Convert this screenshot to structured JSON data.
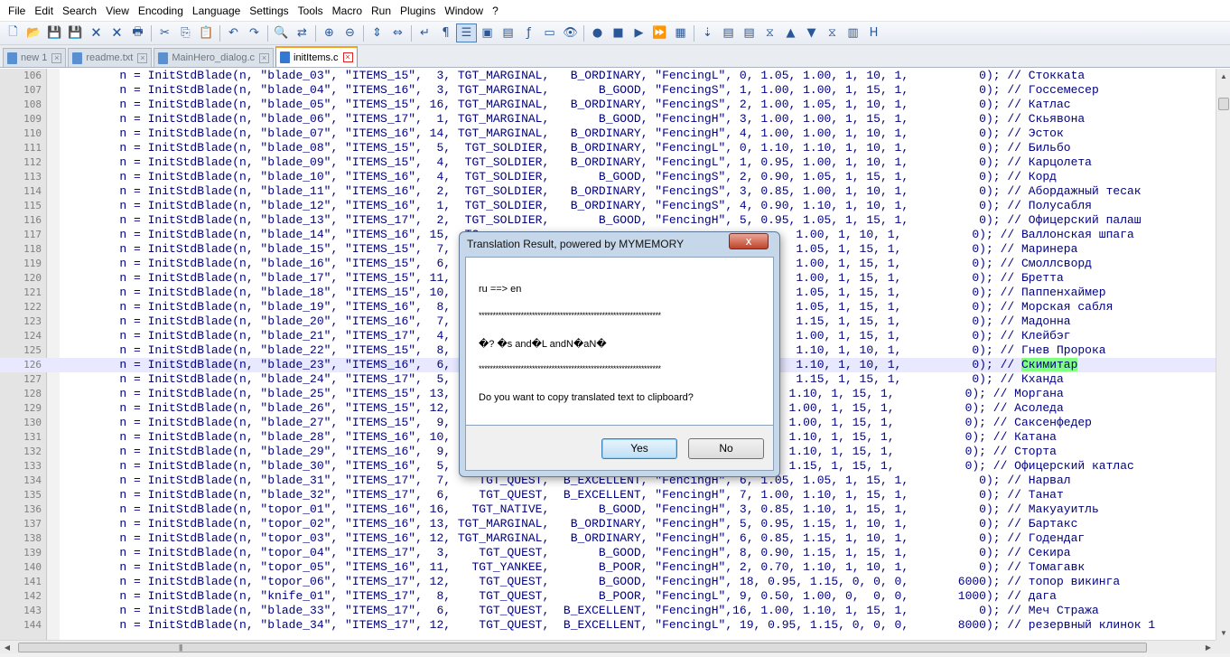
{
  "menu": [
    "File",
    "Edit",
    "Search",
    "View",
    "Encoding",
    "Language",
    "Settings",
    "Tools",
    "Macro",
    "Run",
    "Plugins",
    "Window",
    "?"
  ],
  "toolbar": {
    "icons": [
      {
        "name": "new-file-icon",
        "glyph": "🗋"
      },
      {
        "name": "open-file-icon",
        "glyph": "📂"
      },
      {
        "name": "save-icon",
        "glyph": "💾"
      },
      {
        "name": "save-all-icon",
        "glyph": "💾"
      },
      {
        "name": "close-icon",
        "glyph": "🗙"
      },
      {
        "name": "close-all-icon",
        "glyph": "🗙"
      },
      {
        "name": "print-icon",
        "glyph": "🖶"
      },
      {
        "sep": true
      },
      {
        "name": "cut-icon",
        "glyph": "✂"
      },
      {
        "name": "copy-icon",
        "glyph": "⎘"
      },
      {
        "name": "paste-icon",
        "glyph": "📋"
      },
      {
        "sep": true
      },
      {
        "name": "undo-icon",
        "glyph": "↶"
      },
      {
        "name": "redo-icon",
        "glyph": "↷"
      },
      {
        "sep": true
      },
      {
        "name": "find-icon",
        "glyph": "🔍"
      },
      {
        "name": "replace-icon",
        "glyph": "⇄"
      },
      {
        "sep": true
      },
      {
        "name": "zoom-in-icon",
        "glyph": "⊕"
      },
      {
        "name": "zoom-out-icon",
        "glyph": "⊖"
      },
      {
        "sep": true
      },
      {
        "name": "sync-vertical-icon",
        "glyph": "⇕"
      },
      {
        "name": "sync-horizontal-icon",
        "glyph": "⇔"
      },
      {
        "sep": true
      },
      {
        "name": "word-wrap-icon",
        "glyph": "↵"
      },
      {
        "name": "show-all-chars-icon",
        "glyph": "¶"
      },
      {
        "name": "indent-guide-icon",
        "glyph": "☰",
        "active": true
      },
      {
        "name": "user-lang-icon",
        "glyph": "▣"
      },
      {
        "name": "doc-map-icon",
        "glyph": "▤"
      },
      {
        "name": "function-list-icon",
        "glyph": "ƒ"
      },
      {
        "name": "folder-workspace-icon",
        "glyph": "▭"
      },
      {
        "name": "monitoring-icon",
        "glyph": "👁"
      },
      {
        "sep": true
      },
      {
        "name": "record-macro-icon",
        "glyph": "●"
      },
      {
        "name": "stop-record-icon",
        "glyph": "■"
      },
      {
        "name": "play-macro-icon",
        "glyph": "▶"
      },
      {
        "name": "run-macro-multiple-icon",
        "glyph": "⏩"
      },
      {
        "name": "save-macro-icon",
        "glyph": "▦"
      },
      {
        "sep": true
      },
      {
        "name": "translate-icon",
        "glyph": "⇣"
      },
      {
        "name": "plugin-a-icon",
        "glyph": "▤"
      },
      {
        "name": "plugin-b-icon",
        "glyph": "▤"
      },
      {
        "name": "plugin-c-icon",
        "glyph": "⧖"
      },
      {
        "name": "arrow-up-icon",
        "glyph": "▲"
      },
      {
        "name": "arrow-down-icon",
        "glyph": "▼"
      },
      {
        "name": "plugin-d-icon",
        "glyph": "⧖"
      },
      {
        "name": "plugin-e-icon",
        "glyph": "▥"
      },
      {
        "name": "plugin-h-icon",
        "glyph": "H"
      }
    ]
  },
  "tabs": [
    {
      "label": "new 1",
      "active": false
    },
    {
      "label": "readme.txt",
      "active": false
    },
    {
      "label": "MainHero_dialog.c",
      "active": false
    },
    {
      "label": "initItems.c",
      "active": true
    }
  ],
  "editor": {
    "current_line": 126,
    "highlight_word": "Скимитар",
    "lines": [
      {
        "n": "106",
        "text": "        n = InitStdBlade(n, \"blade_03\", \"ITEMS_15\",  3, TGT_MARGINAL,   B_ORDINARY, \"FencingL\", 0, 1.05, 1.00, 1, 10, 1,          0); // Стоккаta"
      },
      {
        "n": "107",
        "text": "        n = InitStdBlade(n, \"blade_04\", \"ITEMS_16\",  3, TGT_MARGINAL,       B_GOOD, \"FencingS\", 1, 1.00, 1.00, 1, 15, 1,          0); // Госсемесер"
      },
      {
        "n": "108",
        "text": "        n = InitStdBlade(n, \"blade_05\", \"ITEMS_15\", 16, TGT_MARGINAL,   B_ORDINARY, \"FencingS\", 2, 1.00, 1.05, 1, 10, 1,          0); // Катлас"
      },
      {
        "n": "109",
        "text": "        n = InitStdBlade(n, \"blade_06\", \"ITEMS_17\",  1, TGT_MARGINAL,       B_GOOD, \"FencingH\", 3, 1.00, 1.00, 1, 15, 1,          0); // Скьявона"
      },
      {
        "n": "110",
        "text": "        n = InitStdBlade(n, \"blade_07\", \"ITEMS_16\", 14, TGT_MARGINAL,   B_ORDINARY, \"FencingH\", 4, 1.00, 1.00, 1, 10, 1,          0); // Эсток"
      },
      {
        "n": "111",
        "text": "        n = InitStdBlade(n, \"blade_08\", \"ITEMS_15\",  5,  TGT_SOLDIER,   B_ORDINARY, \"FencingL\", 0, 1.10, 1.10, 1, 10, 1,          0); // Бильбо"
      },
      {
        "n": "112",
        "text": "        n = InitStdBlade(n, \"blade_09\", \"ITEMS_15\",  4,  TGT_SOLDIER,   B_ORDINARY, \"FencingL\", 1, 0.95, 1.00, 1, 10, 1,          0); // Карцолета"
      },
      {
        "n": "113",
        "text": "        n = InitStdBlade(n, \"blade_10\", \"ITEMS_16\",  4,  TGT_SOLDIER,       B_GOOD, \"FencingS\", 2, 0.90, 1.05, 1, 15, 1,          0); // Корд"
      },
      {
        "n": "114",
        "text": "        n = InitStdBlade(n, \"blade_11\", \"ITEMS_16\",  2,  TGT_SOLDIER,   B_ORDINARY, \"FencingS\", 3, 0.85, 1.00, 1, 10, 1,          0); // Абордажный тесак"
      },
      {
        "n": "115",
        "text": "        n = InitStdBlade(n, \"blade_12\", \"ITEMS_16\",  1,  TGT_SOLDIER,   B_ORDINARY, \"FencingS\", 4, 0.90, 1.10, 1, 10, 1,          0); // Полусабля"
      },
      {
        "n": "116",
        "text": "        n = InitStdBlade(n, \"blade_13\", \"ITEMS_17\",  2,  TGT_SOLDIER,       B_GOOD, \"FencingH\", 5, 0.95, 1.05, 1, 15, 1,          0); // Офицерский палаш"
      },
      {
        "n": "117",
        "text": "        n = InitStdBlade(n, \"blade_14\", \"ITEMS_16\", 15,  TG                                             1.00, 1, 10, 1,          0); // Валлонская шпага"
      },
      {
        "n": "118",
        "text": "        n = InitStdBlade(n, \"blade_15\", \"ITEMS_15\",  7,  TG                                             1.05, 1, 15, 1,          0); // Маринера"
      },
      {
        "n": "119",
        "text": "        n = InitStdBlade(n, \"blade_16\", \"ITEMS_15\",  6,  TG                                             1.00, 1, 15, 1,          0); // Смоллсворд"
      },
      {
        "n": "120",
        "text": "        n = InitStdBlade(n, \"blade_17\", \"ITEMS_15\", 11,  TG                                             1.00, 1, 15, 1,          0); // Бретта"
      },
      {
        "n": "121",
        "text": "        n = InitStdBlade(n, \"blade_18\", \"ITEMS_15\", 10,  TG                                             1.05, 1, 15, 1,          0); // Паппенхаймер"
      },
      {
        "n": "122",
        "text": "        n = InitStdBlade(n, \"blade_19\", \"ITEMS_16\",  8,  TG                                             1.05, 1, 15, 1,          0); // Морская сабля"
      },
      {
        "n": "123",
        "text": "        n = InitStdBlade(n, \"blade_20\", \"ITEMS_16\",  7,  TG                                             1.15, 1, 15, 1,          0); // Мадонна"
      },
      {
        "n": "124",
        "text": "        n = InitStdBlade(n, \"blade_21\", \"ITEMS_17\",  4,  TG                                             1.00, 1, 15, 1,          0); // Клейбэг"
      },
      {
        "n": "125",
        "text": "        n = InitStdBlade(n, \"blade_22\", \"ITEMS_15\",  8,  TG                                             1.10, 1, 10, 1,          0); // Гнев Пророка"
      },
      {
        "n": "126",
        "text": "        n = InitStdBlade(n, \"blade_23\", \"ITEMS_16\",  6,  TG                                             1.10, 1, 10, 1,          0); // Скимитар"
      },
      {
        "n": "127",
        "text": "        n = InitStdBlade(n, \"blade_24\", \"ITEMS_17\",  5,  TG                                             1.15, 1, 15, 1,          0); // Кханда"
      },
      {
        "n": "128",
        "text": "        n = InitStdBlade(n, \"blade_25\", \"ITEMS_15\", 13,                                                1.10, 1, 15, 1,          0); // Моргана"
      },
      {
        "n": "129",
        "text": "        n = InitStdBlade(n, \"blade_26\", \"ITEMS_15\", 12,                                                1.00, 1, 15, 1,          0); // Асоледа"
      },
      {
        "n": "130",
        "text": "        n = InitStdBlade(n, \"blade_27\", \"ITEMS_15\",  9,                                                1.00, 1, 15, 1,          0); // Саксенфедер"
      },
      {
        "n": "131",
        "text": "        n = InitStdBlade(n, \"blade_28\", \"ITEMS_16\", 10,                                                1.10, 1, 15, 1,          0); // Катана"
      },
      {
        "n": "132",
        "text": "        n = InitStdBlade(n, \"blade_29\", \"ITEMS_16\",  9,                                                1.10, 1, 15, 1,          0); // Сторта"
      },
      {
        "n": "133",
        "text": "        n = InitStdBlade(n, \"blade_30\", \"ITEMS_16\",  5,                                                1.15, 1, 15, 1,          0); // Офицерский катлас"
      },
      {
        "n": "134",
        "text": "        n = InitStdBlade(n, \"blade_31\", \"ITEMS_17\",  7,    TGT_QUEST,  B_EXCELLENT, \"FencingH\", 6, 1.05, 1.05, 1, 15, 1,          0); // Нарвал"
      },
      {
        "n": "135",
        "text": "        n = InitStdBlade(n, \"blade_32\", \"ITEMS_17\",  6,    TGT_QUEST,  B_EXCELLENT, \"FencingH\", 7, 1.00, 1.10, 1, 15, 1,          0); // Танат"
      },
      {
        "n": "136",
        "text": "        n = InitStdBlade(n, \"topor_01\", \"ITEMS_16\", 16,   TGT_NATIVE,       B_GOOD, \"FencingH\", 3, 0.85, 1.10, 1, 15, 1,          0); // Макуауитль"
      },
      {
        "n": "137",
        "text": "        n = InitStdBlade(n, \"topor_02\", \"ITEMS_16\", 13, TGT_MARGINAL,   B_ORDINARY, \"FencingH\", 5, 0.95, 1.15, 1, 10, 1,          0); // Бартакс"
      },
      {
        "n": "138",
        "text": "        n = InitStdBlade(n, \"topor_03\", \"ITEMS_16\", 12, TGT_MARGINAL,   B_ORDINARY, \"FencingH\", 6, 0.85, 1.15, 1, 10, 1,          0); // Годендаг"
      },
      {
        "n": "139",
        "text": "        n = InitStdBlade(n, \"topor_04\", \"ITEMS_17\",  3,    TGT_QUEST,       B_GOOD, \"FencingH\", 8, 0.90, 1.15, 1, 15, 1,          0); // Секира"
      },
      {
        "n": "140",
        "text": "        n = InitStdBlade(n, \"topor_05\", \"ITEMS_16\", 11,   TGT_YANKEE,       B_POOR, \"FencingH\", 2, 0.70, 1.10, 1, 10, 1,          0); // Томагавк"
      },
      {
        "n": "141",
        "text": "        n = InitStdBlade(n, \"topor_06\", \"ITEMS_17\", 12,    TGT_QUEST,       B_GOOD, \"FencingH\", 18, 0.95, 1.15, 0, 0, 0,       6000); // топор викинга"
      },
      {
        "n": "142",
        "text": "        n = InitStdBlade(n, \"knife_01\", \"ITEMS_17\",  8,    TGT_QUEST,       B_POOR, \"FencingL\", 9, 0.50, 1.00, 0,  0, 0,       1000); // дага"
      },
      {
        "n": "143",
        "text": "        n = InitStdBlade(n, \"blade_33\", \"ITEMS_17\",  6,    TGT_QUEST,  B_EXCELLENT, \"FencingH\",16, 1.00, 1.10, 1, 15, 1,          0); // Меч Стража"
      },
      {
        "n": "144",
        "text": "        n = InitStdBlade(n, \"blade_34\", \"ITEMS_17\", 12,    TGT_QUEST,  B_EXCELLENT, \"FencingL\", 19, 0.95, 1.15, 0, 0, 0,       8000); // резервный клинок 1"
      }
    ]
  },
  "dialog": {
    "title": "Translation Result, powered by MYMEMORY",
    "close_label": "x",
    "direction": "ru ==> en",
    "separator": "*****************************************************************",
    "result": "\u0000? \u0000s and\u0000L andN\u0000aN\u0000",
    "result_display": "�? �s and�L andN�aN�",
    "question": "Do you want to copy translated text to clipboard?",
    "yes_label": "Yes",
    "no_label": "No"
  }
}
